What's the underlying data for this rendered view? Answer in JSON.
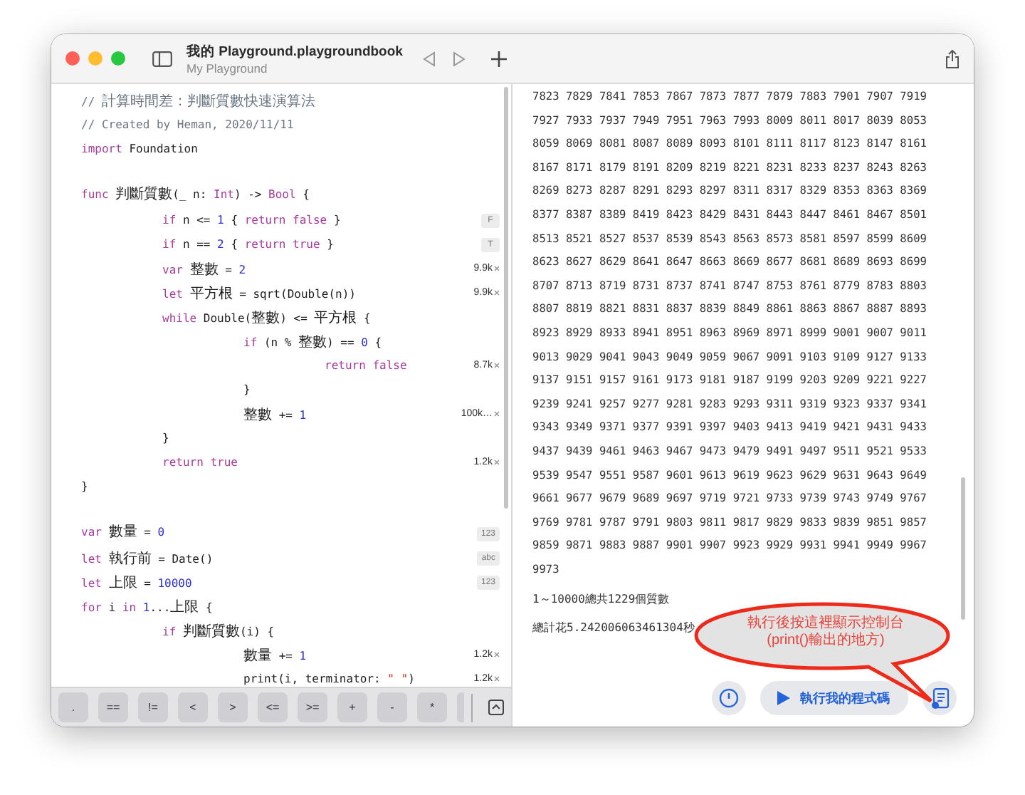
{
  "window": {
    "title": "我的 Playground.playgroundbook",
    "subtitle": "My Playground"
  },
  "code": [
    {
      "tokens": [
        {
          "kind": "comment",
          "text": "// 計算時間差：判斷質數快速演算法"
        }
      ]
    },
    {
      "tokens": [
        {
          "kind": "comment",
          "text": "// Created by Heman, 2020/11/11"
        }
      ]
    },
    {
      "tokens": [
        {
          "kind": "keyword",
          "text": "import"
        },
        {
          "kind": "plain",
          "text": " Foundation"
        }
      ]
    },
    {
      "spaced": true,
      "tokens": [
        {
          "kind": "keyword",
          "text": "func"
        },
        {
          "kind": "plain",
          "text": " 判斷質數(_ n: "
        },
        {
          "kind": "keyword",
          "text": "Int"
        },
        {
          "kind": "plain",
          "text": ") -> "
        },
        {
          "kind": "keyword",
          "text": "Bool"
        },
        {
          "kind": "plain",
          "text": " {"
        }
      ],
      "children": [
        {
          "tokens": [
            {
              "kind": "keyword",
              "text": "if"
            },
            {
              "kind": "plain",
              "text": " n <= "
            },
            {
              "kind": "number",
              "text": "1"
            },
            {
              "kind": "plain",
              "text": " { "
            },
            {
              "kind": "keyword",
              "text": "return false"
            },
            {
              "kind": "plain",
              "text": " }"
            }
          ],
          "result": {
            "kind": "badge",
            "text": "F"
          }
        },
        {
          "tokens": [
            {
              "kind": "keyword",
              "text": "if"
            },
            {
              "kind": "plain",
              "text": " n == "
            },
            {
              "kind": "number",
              "text": "2"
            },
            {
              "kind": "plain",
              "text": " { "
            },
            {
              "kind": "keyword",
              "text": "return true"
            },
            {
              "kind": "plain",
              "text": " }"
            }
          ],
          "result": {
            "kind": "badge",
            "text": "T"
          }
        },
        {
          "tokens": [
            {
              "kind": "keyword",
              "text": "var"
            },
            {
              "kind": "plain",
              "text": " 整數 = "
            },
            {
              "kind": "number",
              "text": "2"
            }
          ],
          "result": {
            "kind": "count",
            "text": "9.9k"
          }
        },
        {
          "tokens": [
            {
              "kind": "keyword",
              "text": "let"
            },
            {
              "kind": "plain",
              "text": " 平方根 = sqrt(Double(n))"
            }
          ],
          "result": {
            "kind": "count",
            "text": "9.9k"
          }
        },
        {
          "tokens": [
            {
              "kind": "keyword",
              "text": "while"
            },
            {
              "kind": "plain",
              "text": " Double(整數) <= 平方根 {"
            }
          ],
          "children": [
            {
              "tokens": [
                {
                  "kind": "keyword",
                  "text": "if"
                },
                {
                  "kind": "plain",
                  "text": " (n % 整數) == "
                },
                {
                  "kind": "number",
                  "text": "0"
                },
                {
                  "kind": "plain",
                  "text": " {"
                }
              ],
              "children": [
                {
                  "tokens": [
                    {
                      "kind": "keyword",
                      "text": "return false"
                    }
                  ],
                  "result": {
                    "kind": "count",
                    "text": "8.7k"
                  }
                }
              ]
            },
            {
              "tokens": [
                {
                  "kind": "plain",
                  "text": "}"
                }
              ]
            },
            {
              "tokens": [
                {
                  "kind": "plain",
                  "text": "整數 += "
                },
                {
                  "kind": "number",
                  "text": "1"
                }
              ],
              "result": {
                "kind": "count",
                "text": "100k…"
              }
            }
          ]
        },
        {
          "tokens": [
            {
              "kind": "plain",
              "text": "}"
            }
          ]
        },
        {
          "tokens": [
            {
              "kind": "keyword",
              "text": "return true"
            }
          ],
          "result": {
            "kind": "count",
            "text": "1.2k"
          }
        }
      ]
    },
    {
      "tokens": [
        {
          "kind": "plain",
          "text": "}"
        }
      ]
    },
    {
      "spaced": true,
      "tokens": [
        {
          "kind": "keyword",
          "text": "var"
        },
        {
          "kind": "plain",
          "text": " 數量 = "
        },
        {
          "kind": "number",
          "text": "0"
        }
      ],
      "result": {
        "kind": "badge",
        "text": "123"
      }
    },
    {
      "tokens": [
        {
          "kind": "keyword",
          "text": "let"
        },
        {
          "kind": "plain",
          "text": " 執行前 = Date()"
        }
      ],
      "result": {
        "kind": "badge",
        "text": "abc"
      }
    },
    {
      "tokens": [
        {
          "kind": "keyword",
          "text": "let"
        },
        {
          "kind": "plain",
          "text": " 上限 = "
        },
        {
          "kind": "number",
          "text": "10000"
        }
      ],
      "result": {
        "kind": "badge",
        "text": "123"
      }
    },
    {
      "tokens": [
        {
          "kind": "keyword",
          "text": "for"
        },
        {
          "kind": "plain",
          "text": " i "
        },
        {
          "kind": "keyword",
          "text": "in"
        },
        {
          "kind": "number",
          "text": " 1"
        },
        {
          "kind": "plain",
          "text": "...上限 {"
        }
      ],
      "children": [
        {
          "tokens": [
            {
              "kind": "keyword",
              "text": "if"
            },
            {
              "kind": "plain",
              "text": " 判斷質數(i) {"
            }
          ],
          "children": [
            {
              "tokens": [
                {
                  "kind": "plain",
                  "text": "數量 += "
                },
                {
                  "kind": "number",
                  "text": "1"
                }
              ],
              "result": {
                "kind": "count",
                "text": "1.2k"
              }
            },
            {
              "tokens": [
                {
                  "kind": "plain",
                  "text": "print(i, terminator: "
                },
                {
                  "kind": "string",
                  "text": "\" \""
                },
                {
                  "kind": "plain",
                  "text": ")"
                }
              ],
              "result": {
                "kind": "count",
                "text": "1.2k"
              }
            }
          ]
        }
      ]
    }
  ],
  "keyboard_keys": [
    ".",
    "==",
    "!=",
    "<",
    ">",
    "<=",
    ">=",
    "+",
    "-",
    "*"
  ],
  "console": {
    "lines": [
      "7823 7829 7841 7853 7867 7873 7877 7879 7883 7901 7907 7919",
      "7927 7933 7937 7949 7951 7963 7993 8009 8011 8017 8039 8053",
      "8059 8069 8081 8087 8089 8093 8101 8111 8117 8123 8147 8161",
      "8167 8171 8179 8191 8209 8219 8221 8231 8233 8237 8243 8263",
      "8269 8273 8287 8291 8293 8297 8311 8317 8329 8353 8363 8369",
      "8377 8387 8389 8419 8423 8429 8431 8443 8447 8461 8467 8501",
      "8513 8521 8527 8537 8539 8543 8563 8573 8581 8597 8599 8609",
      "8623 8627 8629 8641 8647 8663 8669 8677 8681 8689 8693 8699",
      "8707 8713 8719 8731 8737 8741 8747 8753 8761 8779 8783 8803",
      "8807 8819 8821 8831 8837 8839 8849 8861 8863 8867 8887 8893",
      "8923 8929 8933 8941 8951 8963 8969 8971 8999 9001 9007 9011",
      "9013 9029 9041 9043 9049 9059 9067 9091 9103 9109 9127 9133",
      "9137 9151 9157 9161 9173 9181 9187 9199 9203 9209 9221 9227",
      "9239 9241 9257 9277 9281 9283 9293 9311 9319 9323 9337 9341",
      "9343 9349 9371 9377 9391 9397 9403 9413 9419 9421 9431 9433",
      "9437 9439 9461 9463 9467 9473 9479 9491 9497 9511 9521 9533",
      "9539 9547 9551 9587 9601 9613 9619 9623 9629 9631 9643 9649",
      "9661 9677 9679 9689 9697 9719 9721 9733 9739 9743 9749 9767",
      "9769 9781 9787 9791 9803 9811 9817 9829 9833 9839 9851 9857",
      "9859 9871 9883 9887 9901 9907 9923 9929 9931 9941 9949 9967",
      "9973"
    ],
    "summary": [
      "1～10000總共1229個質數",
      "總計花5.242006063461304秒"
    ]
  },
  "callout": {
    "lines": [
      "執行後按這裡顯示控制台",
      "(print()輸出的地方)"
    ]
  },
  "run_button": {
    "label": "執行我的程式碼"
  }
}
